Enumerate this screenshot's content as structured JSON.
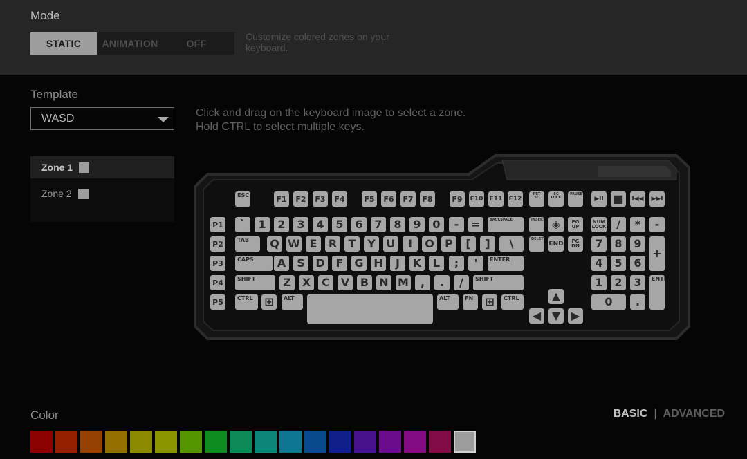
{
  "mode": {
    "title": "Mode",
    "tabs": [
      {
        "label": "STATIC",
        "active": true
      },
      {
        "label": "ANIMATION",
        "active": false
      },
      {
        "label": "OFF",
        "active": false
      }
    ],
    "description": "Customize colored zones on your keyboard."
  },
  "template": {
    "title": "Template",
    "selected": "WASD"
  },
  "zones": [
    {
      "label": "Zone 1",
      "active": true,
      "color": "#9d9d9d"
    },
    {
      "label": "Zone 2",
      "active": false,
      "color": "#9d9d9d"
    }
  ],
  "instructions": {
    "line1": "Click and drag on the keyboard image to select a zone.",
    "line2": "Hold CTRL to select multiple keys."
  },
  "keyboard": {
    "key_color": "#a6a6a6",
    "rows": {
      "fn": [
        "ESC",
        "F1",
        "F2",
        "F3",
        "F4",
        "F5",
        "F6",
        "F7",
        "F8",
        "F9",
        "F10",
        "F11",
        "F12",
        "PRT SC",
        "SC LOCK",
        "PAUSE",
        "▶II",
        "■",
        "I◀◀",
        "▶▶I"
      ],
      "number": [
        "P1",
        "`",
        "1",
        "2",
        "3",
        "4",
        "5",
        "6",
        "7",
        "8",
        "9",
        "0",
        "-",
        "=",
        "BACKSPACE",
        "INSERT",
        "◈",
        "PG UP",
        "NUM LOCK",
        "/",
        "*",
        "-"
      ],
      "tab": [
        "P2",
        "TAB",
        "Q",
        "W",
        "E",
        "R",
        "T",
        "Y",
        "U",
        "I",
        "O",
        "P",
        "[",
        "]",
        "\\",
        "DELETE",
        "END",
        "PG DN",
        "7",
        "8",
        "9",
        "+"
      ],
      "caps": [
        "P3",
        "CAPS",
        "A",
        "S",
        "D",
        "F",
        "G",
        "H",
        "J",
        "K",
        "L",
        ";",
        "'",
        "ENTER",
        "4",
        "5",
        "6"
      ],
      "shift": [
        "P4",
        "SHIFT",
        "Z",
        "X",
        "C",
        "V",
        "B",
        "N",
        "M",
        ",",
        ".",
        "/",
        "SHIFT",
        "▲",
        "1",
        "2",
        "3",
        "ENTER"
      ],
      "ctrl": [
        "P5",
        "CTRL",
        "⊞",
        "ALT",
        "",
        "ALT",
        "FN",
        "⊞",
        "CTRL",
        "◀",
        "▼",
        "▶",
        "0",
        "."
      ]
    }
  },
  "color": {
    "title": "Color",
    "modes": {
      "basic": "BASIC",
      "separator": "|",
      "advanced": "ADVANCED"
    },
    "swatches": [
      "#8b0000",
      "#952000",
      "#944000",
      "#937000",
      "#8c8a00",
      "#8a9500",
      "#559500",
      "#0e8a1e",
      "#0e8a58",
      "#0e877a",
      "#0e7690",
      "#084a8c",
      "#0f1f8c",
      "#47138c",
      "#6a0c8c",
      "#820a82",
      "#820c45",
      "#9d9d9d"
    ],
    "selected_index": 17
  }
}
